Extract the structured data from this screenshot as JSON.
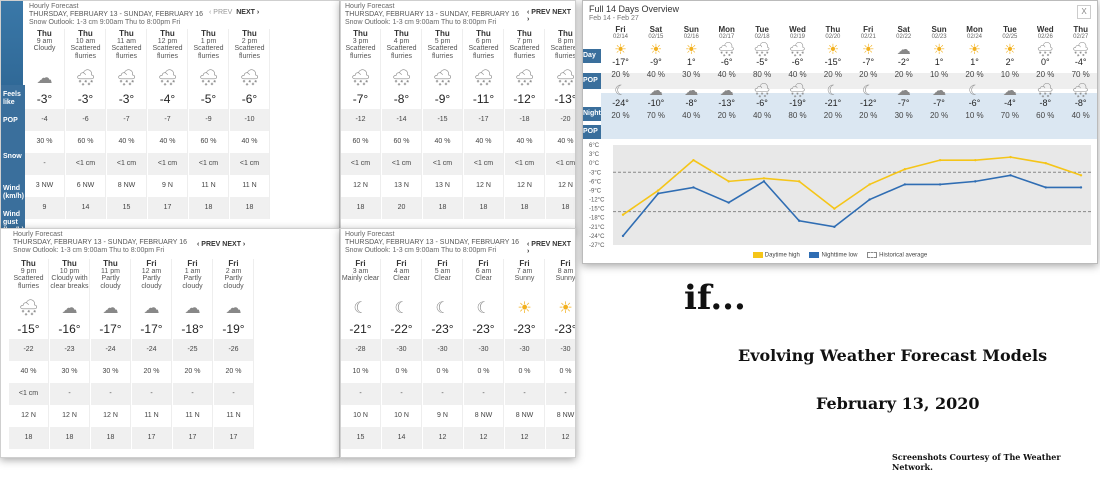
{
  "p1": {
    "title": "Hourly Forecast",
    "range": "THURSDAY, FEBRUARY 13 - SUNDAY, FEBRUARY 16",
    "outlook": "Snow Outlook: 1-3 cm 9:00am Thu to 8:00pm Fri",
    "prev": "‹ PREV",
    "next": "NEXT ›",
    "labels": [
      "Feels like",
      "POP",
      "Snow",
      "Wind (km/h)",
      "Wind gust (km/h)"
    ],
    "cols": [
      {
        "d": "Thu",
        "t": "9 am",
        "c": "Cloudy",
        "i": "☁",
        "tmp": "-3°",
        "fl": "-4",
        "pop": "30 %",
        "snow": "-",
        "wind": "3 NW",
        "gust": "9"
      },
      {
        "d": "Thu",
        "t": "10 am",
        "c": "Scattered flurries",
        "i": "🌨",
        "tmp": "-3°",
        "fl": "-6",
        "pop": "60 %",
        "snow": "<1 cm",
        "wind": "6 NW",
        "gust": "14"
      },
      {
        "d": "Thu",
        "t": "11 am",
        "c": "Scattered flurries",
        "i": "🌨",
        "tmp": "-3°",
        "fl": "-7",
        "pop": "40 %",
        "snow": "<1 cm",
        "wind": "8 NW",
        "gust": "15"
      },
      {
        "d": "Thu",
        "t": "12 pm",
        "c": "Scattered flurries",
        "i": "🌨",
        "tmp": "-4°",
        "fl": "-7",
        "pop": "40 %",
        "snow": "<1 cm",
        "wind": "9 N",
        "gust": "17"
      },
      {
        "d": "Thu",
        "t": "1 pm",
        "c": "Scattered flurries",
        "i": "🌨",
        "tmp": "-5°",
        "fl": "-9",
        "pop": "60 %",
        "snow": "<1 cm",
        "wind": "11 N",
        "gust": "18"
      },
      {
        "d": "Thu",
        "t": "2 pm",
        "c": "Scattered flurries",
        "i": "🌨",
        "tmp": "-6°",
        "fl": "-10",
        "pop": "40 %",
        "snow": "<1 cm",
        "wind": "11 N",
        "gust": "18"
      }
    ]
  },
  "p2": {
    "title": "Hourly Forecast",
    "range": "THURSDAY, FEBRUARY 13 - SUNDAY, FEBRUARY 16",
    "outlook": "Snow Outlook: 1-3 cm 9:00am Thu to 8:00pm Fri",
    "prev": "‹ PREV",
    "next": "NEXT ›",
    "cols": [
      {
        "d": "Thu",
        "t": "3 pm",
        "c": "Scattered flurries",
        "i": "🌨",
        "tmp": "-7°",
        "fl": "-12",
        "pop": "60 %",
        "snow": "<1 cm",
        "wind": "12 N",
        "gust": "18"
      },
      {
        "d": "Thu",
        "t": "4 pm",
        "c": "Scattered flurries",
        "i": "🌨",
        "tmp": "-8°",
        "fl": "-14",
        "pop": "60 %",
        "snow": "<1 cm",
        "wind": "13 N",
        "gust": "20"
      },
      {
        "d": "Thu",
        "t": "5 pm",
        "c": "Scattered flurries",
        "i": "🌨",
        "tmp": "-9°",
        "fl": "-15",
        "pop": "40 %",
        "snow": "<1 cm",
        "wind": "13 N",
        "gust": "18"
      },
      {
        "d": "Thu",
        "t": "6 pm",
        "c": "Scattered flurries",
        "i": "🌨",
        "tmp": "-11°",
        "fl": "-17",
        "pop": "40 %",
        "snow": "<1 cm",
        "wind": "12 N",
        "gust": "18"
      },
      {
        "d": "Thu",
        "t": "7 pm",
        "c": "Scattered flurries",
        "i": "🌨",
        "tmp": "-12°",
        "fl": "-18",
        "pop": "40 %",
        "snow": "<1 cm",
        "wind": "12 N",
        "gust": "18"
      },
      {
        "d": "Thu",
        "t": "8 pm",
        "c": "Scattered flurries",
        "i": "🌨",
        "tmp": "-13°",
        "fl": "-20",
        "pop": "40 %",
        "snow": "<1 cm",
        "wind": "12 N",
        "gust": "18"
      }
    ]
  },
  "p3": {
    "title": "Hourly Forecast",
    "range": "THURSDAY, FEBRUARY 13 - SUNDAY, FEBRUARY 16",
    "outlook": "Snow Outlook: 1-3 cm 9:00am Thu to 8:00pm Fri",
    "prev": "‹ PREV",
    "next": "NEXT ›",
    "cols": [
      {
        "d": "Thu",
        "t": "9 pm",
        "c": "Scattered flurries",
        "i": "🌨",
        "tmp": "-15°",
        "fl": "-22",
        "pop": "40 %",
        "snow": "<1 cm",
        "wind": "12 N",
        "gust": "18"
      },
      {
        "d": "Thu",
        "t": "10 pm",
        "c": "Cloudy with clear breaks",
        "i": "☁",
        "tmp": "-16°",
        "fl": "-23",
        "pop": "30 %",
        "snow": "-",
        "wind": "12 N",
        "gust": "18"
      },
      {
        "d": "Thu",
        "t": "11 pm",
        "c": "Partly cloudy",
        "i": "☁",
        "tmp": "-17°",
        "fl": "-24",
        "pop": "30 %",
        "snow": "-",
        "wind": "12 N",
        "gust": "18"
      },
      {
        "d": "Fri",
        "t": "12 am",
        "c": "Partly cloudy",
        "i": "☁",
        "tmp": "-17°",
        "fl": "-24",
        "pop": "20 %",
        "snow": "-",
        "wind": "11 N",
        "gust": "17"
      },
      {
        "d": "Fri",
        "t": "1 am",
        "c": "Partly cloudy",
        "i": "☁",
        "tmp": "-18°",
        "fl": "-25",
        "pop": "20 %",
        "snow": "-",
        "wind": "11 N",
        "gust": "17"
      },
      {
        "d": "Fri",
        "t": "2 am",
        "c": "Partly cloudy",
        "i": "☁",
        "tmp": "-19°",
        "fl": "-26",
        "pop": "20 %",
        "snow": "-",
        "wind": "11 N",
        "gust": "17"
      }
    ]
  },
  "p4": {
    "title": "Hourly Forecast",
    "range": "THURSDAY, FEBRUARY 13 - SUNDAY, FEBRUARY 16",
    "outlook": "Snow Outlook: 1-3 cm 9:00am Thu to 8:00pm Fri",
    "prev": "‹ PREV",
    "next": "NEXT ›",
    "cols": [
      {
        "d": "Fri",
        "t": "3 am",
        "c": "Mainly clear",
        "i": "☾",
        "tmp": "-21°",
        "fl": "-28",
        "pop": "10 %",
        "snow": "-",
        "wind": "10 N",
        "gust": "15"
      },
      {
        "d": "Fri",
        "t": "4 am",
        "c": "Clear",
        "i": "☾",
        "tmp": "-22°",
        "fl": "-30",
        "pop": "0 %",
        "snow": "-",
        "wind": "10 N",
        "gust": "14"
      },
      {
        "d": "Fri",
        "t": "5 am",
        "c": "Clear",
        "i": "☾",
        "tmp": "-23°",
        "fl": "-30",
        "pop": "0 %",
        "snow": "-",
        "wind": "9 N",
        "gust": "12"
      },
      {
        "d": "Fri",
        "t": "6 am",
        "c": "Clear",
        "i": "☾",
        "tmp": "-23°",
        "fl": "-30",
        "pop": "0 %",
        "snow": "-",
        "wind": "8 NW",
        "gust": "12"
      },
      {
        "d": "Fri",
        "t": "7 am",
        "c": "Sunny",
        "i": "☀",
        "tmp": "-23°",
        "fl": "-30",
        "pop": "0 %",
        "snow": "-",
        "wind": "8 NW",
        "gust": "12"
      },
      {
        "d": "Fri",
        "t": "8 am",
        "c": "Sunny",
        "i": "☀",
        "tmp": "-23°",
        "fl": "-30",
        "pop": "0 %",
        "snow": "-",
        "wind": "8 NW",
        "gust": "12"
      }
    ]
  },
  "ov": {
    "title": "Full 14 Days Overview",
    "sub": "Feb 14 - Feb 27",
    "close": "X",
    "dayLbl": "Day",
    "popLbl": "POP",
    "nightLbl": "Night",
    "days": [
      {
        "d": "Fri",
        "dt": "02/14",
        "di": "☀",
        "hi": "-17°",
        "pd": "20 %",
        "ni": "☾",
        "lo": "-24°",
        "pn": "20 %"
      },
      {
        "d": "Sat",
        "dt": "02/15",
        "di": "☀",
        "hi": "-9°",
        "pd": "40 %",
        "ni": "☁",
        "lo": "-10°",
        "pn": "70 %"
      },
      {
        "d": "Sun",
        "dt": "02/16",
        "di": "☀",
        "hi": "1°",
        "pd": "30 %",
        "ni": "☁",
        "lo": "-8°",
        "pn": "40 %"
      },
      {
        "d": "Mon",
        "dt": "02/17",
        "di": "🌨",
        "hi": "-6°",
        "pd": "40 %",
        "ni": "☁",
        "lo": "-13°",
        "pn": "20 %"
      },
      {
        "d": "Tue",
        "dt": "02/18",
        "di": "🌨",
        "hi": "-5°",
        "pd": "80 %",
        "ni": "🌨",
        "lo": "-6°",
        "pn": "40 %"
      },
      {
        "d": "Wed",
        "dt": "02/19",
        "di": "🌨",
        "hi": "-6°",
        "pd": "40 %",
        "ni": "🌨",
        "lo": "-19°",
        "pn": "80 %"
      },
      {
        "d": "Thu",
        "dt": "02/20",
        "di": "☀",
        "hi": "-15°",
        "pd": "20 %",
        "ni": "☾",
        "lo": "-21°",
        "pn": "20 %"
      },
      {
        "d": "Fri",
        "dt": "02/21",
        "di": "☀",
        "hi": "-7°",
        "pd": "20 %",
        "ni": "☾",
        "lo": "-12°",
        "pn": "20 %"
      },
      {
        "d": "Sat",
        "dt": "02/22",
        "di": "☁",
        "hi": "-2°",
        "pd": "20 %",
        "ni": "☁",
        "lo": "-7°",
        "pn": "30 %"
      },
      {
        "d": "Sun",
        "dt": "02/23",
        "di": "☀",
        "hi": "1°",
        "pd": "10 %",
        "ni": "☁",
        "lo": "-7°",
        "pn": "20 %"
      },
      {
        "d": "Mon",
        "dt": "02/24",
        "di": "☀",
        "hi": "1°",
        "pd": "20 %",
        "ni": "☾",
        "lo": "-6°",
        "pn": "10 %"
      },
      {
        "d": "Tue",
        "dt": "02/25",
        "di": "☀",
        "hi": "2°",
        "pd": "10 %",
        "ni": "☁",
        "lo": "-4°",
        "pn": "70 %"
      },
      {
        "d": "Wed",
        "dt": "02/26",
        "di": "🌨",
        "hi": "0°",
        "pd": "20 %",
        "ni": "🌨",
        "lo": "-8°",
        "pn": "60 %"
      },
      {
        "d": "Thu",
        "dt": "02/27",
        "di": "🌨",
        "hi": "-4°",
        "pd": "70 %",
        "ni": "🌨",
        "lo": "-8°",
        "pn": "40 %"
      }
    ]
  },
  "chart_data": {
    "type": "line",
    "x": [
      "02/14",
      "02/15",
      "02/16",
      "02/17",
      "02/18",
      "02/19",
      "02/20",
      "02/21",
      "02/22",
      "02/23",
      "02/24",
      "02/25",
      "02/26",
      "02/27"
    ],
    "series": [
      {
        "name": "Daytime high",
        "color": "#f5c518",
        "values": [
          -17,
          -9,
          1,
          -6,
          -5,
          -6,
          -15,
          -7,
          -2,
          1,
          1,
          2,
          0,
          -4
        ]
      },
      {
        "name": "Nighttime low",
        "color": "#2f6db3",
        "values": [
          -24,
          -10,
          -8,
          -13,
          -6,
          -19,
          -21,
          -12,
          -7,
          -7,
          -6,
          -4,
          -8,
          -8
        ]
      }
    ],
    "historical": {
      "name": "Historical average",
      "hi": -3,
      "lo": -16
    },
    "yticks": [
      "6°C",
      "3°C",
      "0°C",
      "-3°C",
      "-6°C",
      "-9°C",
      "-12°C",
      "-15°C",
      "-18°C",
      "-21°C",
      "-24°C",
      "-27°C"
    ],
    "ylim": [
      -27,
      6
    ],
    "legend": "bottom"
  },
  "text": {
    "if": "if...",
    "headline": "Evolving Weather Forecast Models",
    "date": "February 13, 2020",
    "credit": "Screenshots Courtesy of The Weather Network."
  }
}
